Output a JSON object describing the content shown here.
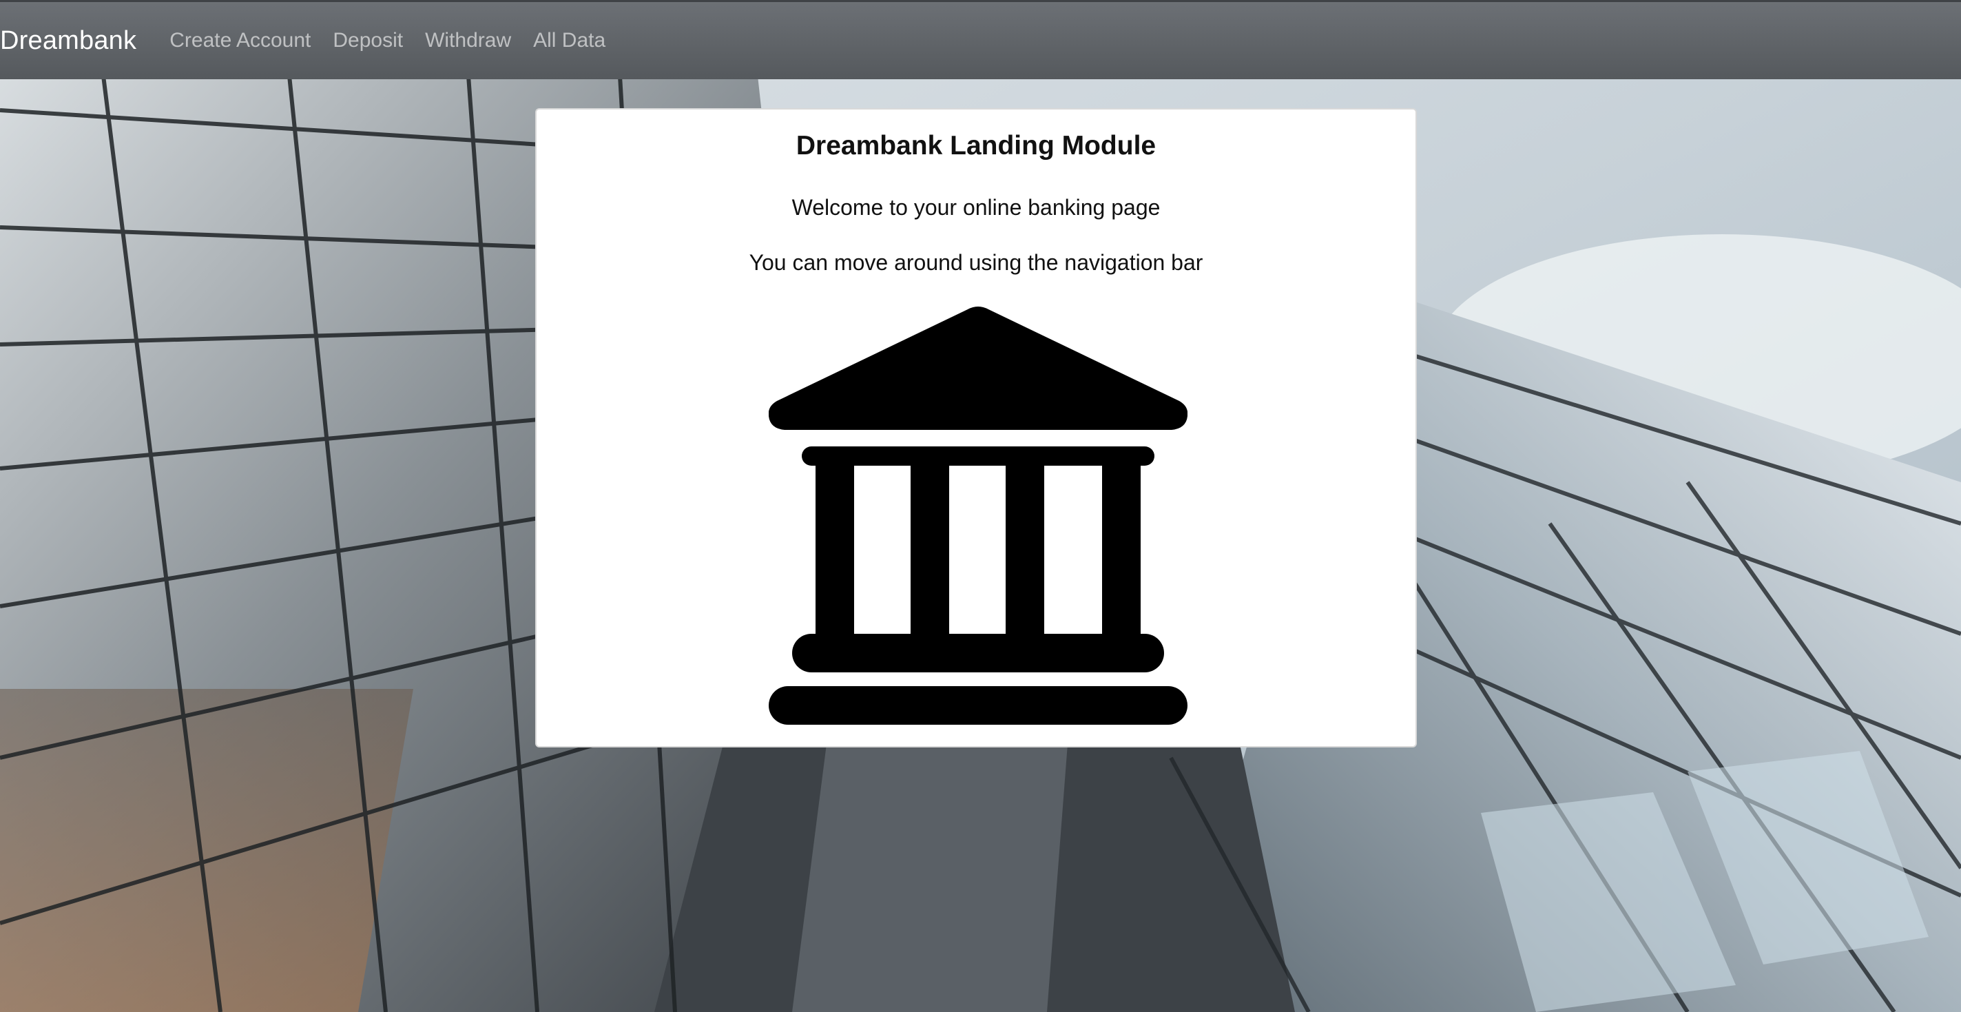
{
  "navbar": {
    "brand": "Dreambank",
    "links": [
      {
        "label": "Create Account"
      },
      {
        "label": "Deposit"
      },
      {
        "label": "Withdraw"
      },
      {
        "label": "All Data"
      }
    ]
  },
  "card": {
    "title": "Dreambank Landing Module",
    "welcome": "Welcome to your online banking page",
    "hint": "You can move around using the navigation bar",
    "icon": "bank-building-icon"
  },
  "colors": {
    "navbar_bg": "#5f6368",
    "brand_text": "#ffffff",
    "nav_link_text": "rgba(255,255,255,0.6)",
    "card_bg": "#ffffff",
    "icon_fill": "#000000"
  }
}
